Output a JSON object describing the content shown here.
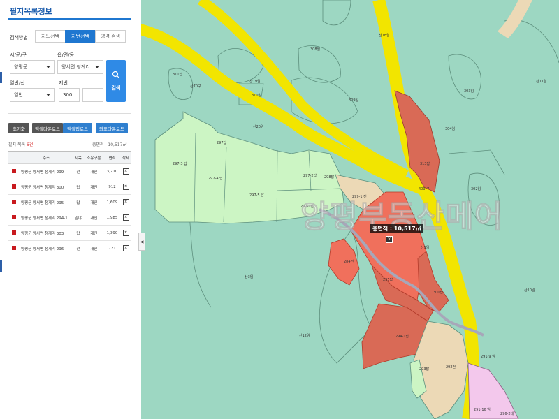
{
  "panel": {
    "title": "필지목록정보",
    "search_method_label": "검색방법",
    "tabs": [
      "지도선택",
      "지번선택",
      "영역 검색"
    ],
    "active_tab": 1,
    "sigungu": {
      "label": "시/군/구",
      "value": "양평군"
    },
    "eupmyeondong": {
      "label": "읍/면/동",
      "value": "양서면 청계리"
    },
    "ilban_san": {
      "label": "일반/산",
      "value": "일반"
    },
    "jibun": {
      "label": "지번",
      "value": "300",
      "value2": ""
    },
    "search_button": "검색",
    "buttons": {
      "reset": "초기화",
      "excel_up": "엑셀다운로드",
      "excel_upload": "엑셀업로드",
      "coord_down": "좌표다운로드"
    },
    "summary": {
      "prefix": "필지 목록",
      "count": "6건",
      "total": "총면적 : 10,517㎡"
    },
    "table": {
      "headers": [
        "주소",
        "지목",
        "소유구분",
        "면적",
        "삭제"
      ],
      "rows": [
        {
          "addr": "양평군 양서면 청계리 299",
          "jimok": "전",
          "owner": "개인",
          "area": "3,210"
        },
        {
          "addr": "양평군 양서면 청계리 300",
          "jimok": "답",
          "owner": "개인",
          "area": "912"
        },
        {
          "addr": "양평군 양서면 청계리 295",
          "jimok": "답",
          "owner": "개인",
          "area": "1,609"
        },
        {
          "addr": "양평군 양서면 청계리 294-1",
          "jimok": "임야",
          "owner": "개인",
          "area": "1,985"
        },
        {
          "addr": "양평군 양서면 청계리 303",
          "jimok": "답",
          "owner": "개인",
          "area": "1,390"
        },
        {
          "addr": "양평군 양서면 청계리 296",
          "jimok": "전",
          "owner": "개인",
          "area": "721"
        }
      ]
    }
  },
  "map": {
    "watermark": "양평부동산메어",
    "total_area_label": "총면적 : 10,517㎡",
    "parcel_labels": [
      "308임",
      "311답",
      "산18임",
      "산19임",
      "310임",
      "309임",
      "산70구",
      "297답",
      "산20임",
      "297-3 답",
      "297-4 답",
      "297-5 답",
      "297-2답",
      "298답",
      "297-1답",
      "299-1 전",
      "409 구",
      "산11임",
      "303임",
      "304임",
      "313답",
      "302임",
      "284전",
      "295답",
      "300답",
      "294-1답",
      "293답",
      "292전",
      "산9임",
      "산10임",
      "산12임",
      "291-9 임",
      "291-16 임",
      "296-2대",
      "산3임"
    ],
    "colors": {
      "base": "#9dd7c2",
      "road": "#f2e500",
      "selected": "#f0705c",
      "selected_dark": "#d96a56",
      "farm": "#ccf5c4",
      "field": "#ecd9b6"
    }
  }
}
